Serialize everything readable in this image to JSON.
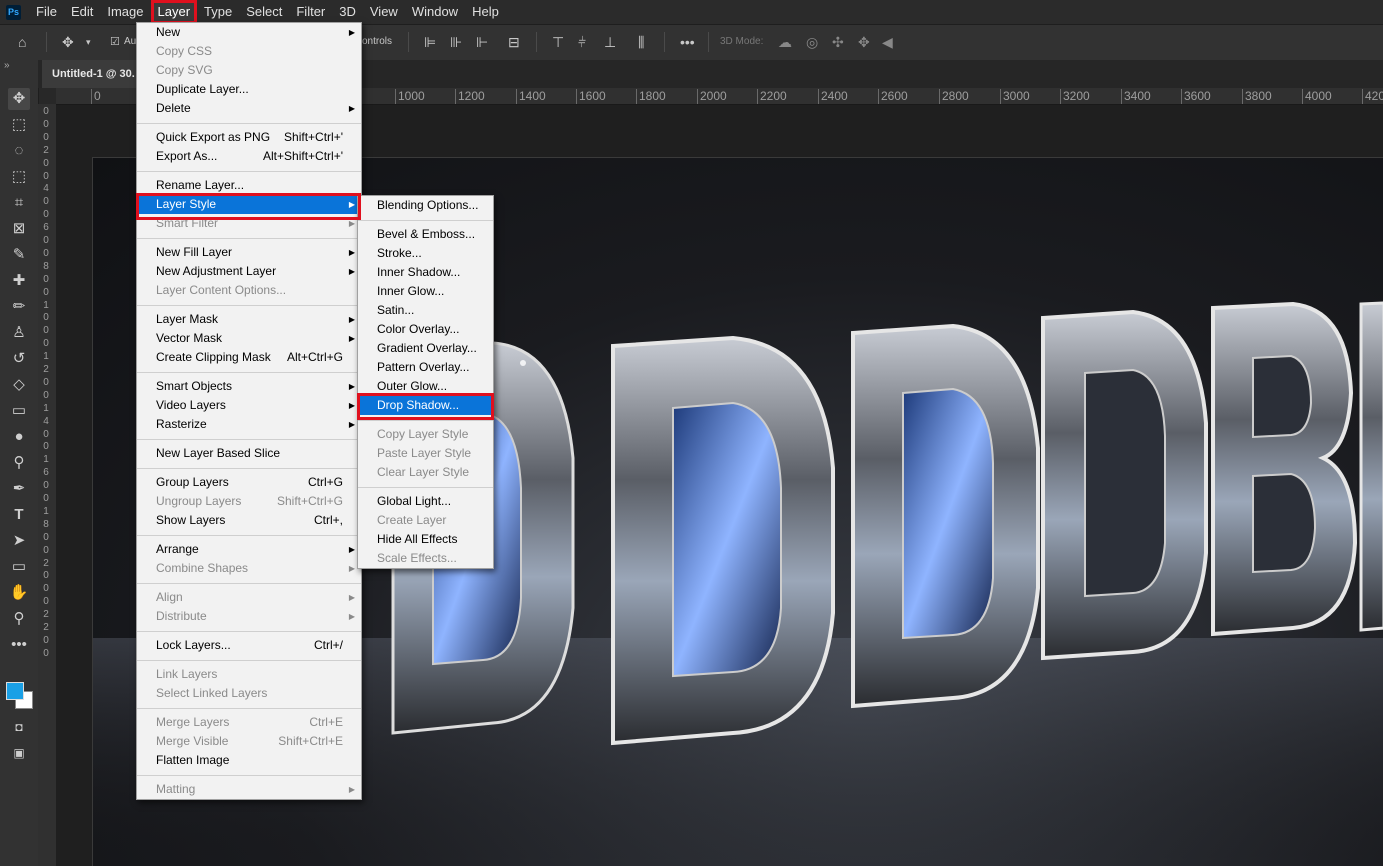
{
  "app": {
    "logo": "Ps"
  },
  "menubar": [
    "File",
    "Edit",
    "Image",
    "Layer",
    "Type",
    "Select",
    "Filter",
    "3D",
    "View",
    "Window",
    "Help"
  ],
  "optionsbar": {
    "auto_label": "Au",
    "controls_label": "ontrols",
    "mode_label": "3D Mode:"
  },
  "document": {
    "tab_label": "Untitled-1 @ 30."
  },
  "ruler": {
    "top": [
      "0",
      "1000",
      "1200",
      "1400",
      "1600",
      "1800",
      "2000",
      "2200",
      "2400",
      "2600",
      "2800",
      "3000",
      "3200",
      "3400",
      "3600",
      "3800",
      "4000",
      "420"
    ],
    "left": [
      "0",
      "0",
      "0",
      "2",
      "0",
      "0",
      "4",
      "0",
      "0",
      "6",
      "0",
      "0",
      "8",
      "0",
      "0",
      "1",
      "0",
      "0",
      "0",
      "1",
      "2",
      "0",
      "0",
      "1",
      "4",
      "0",
      "0",
      "1",
      "6",
      "0",
      "0",
      "1",
      "8",
      "0",
      "0",
      "2",
      "0",
      "0",
      "0",
      "2",
      "2",
      "0",
      "0"
    ]
  },
  "layer_menu": [
    {
      "label": "New",
      "arrow": true
    },
    {
      "label": "Copy CSS",
      "disabled": true
    },
    {
      "label": "Copy SVG",
      "disabled": true
    },
    {
      "label": "Duplicate Layer..."
    },
    {
      "label": "Delete",
      "arrow": true
    },
    {
      "sep": true
    },
    {
      "label": "Quick Export as PNG",
      "shortcut": "Shift+Ctrl+'"
    },
    {
      "label": "Export As...",
      "shortcut": "Alt+Shift+Ctrl+'"
    },
    {
      "sep": true
    },
    {
      "label": "Rename Layer..."
    },
    {
      "label": "Layer Style",
      "arrow": true,
      "highlight": true
    },
    {
      "label": "Smart Filter",
      "arrow": true,
      "disabled": true
    },
    {
      "sep": true
    },
    {
      "label": "New Fill Layer",
      "arrow": true
    },
    {
      "label": "New Adjustment Layer",
      "arrow": true
    },
    {
      "label": "Layer Content Options...",
      "disabled": true
    },
    {
      "sep": true
    },
    {
      "label": "Layer Mask",
      "arrow": true
    },
    {
      "label": "Vector Mask",
      "arrow": true
    },
    {
      "label": "Create Clipping Mask",
      "shortcut": "Alt+Ctrl+G"
    },
    {
      "sep": true
    },
    {
      "label": "Smart Objects",
      "arrow": true
    },
    {
      "label": "Video Layers",
      "arrow": true
    },
    {
      "label": "Rasterize",
      "arrow": true
    },
    {
      "sep": true
    },
    {
      "label": "New Layer Based Slice"
    },
    {
      "sep": true
    },
    {
      "label": "Group Layers",
      "shortcut": "Ctrl+G"
    },
    {
      "label": "Ungroup Layers",
      "shortcut": "Shift+Ctrl+G",
      "disabled": true
    },
    {
      "label": "Show Layers",
      "shortcut": "Ctrl+,"
    },
    {
      "sep": true
    },
    {
      "label": "Arrange",
      "arrow": true
    },
    {
      "label": "Combine Shapes",
      "arrow": true,
      "disabled": true
    },
    {
      "sep": true
    },
    {
      "label": "Align",
      "arrow": true,
      "disabled": true
    },
    {
      "label": "Distribute",
      "arrow": true,
      "disabled": true
    },
    {
      "sep": true
    },
    {
      "label": "Lock Layers...",
      "shortcut": "Ctrl+/"
    },
    {
      "sep": true
    },
    {
      "label": "Link Layers",
      "disabled": true
    },
    {
      "label": "Select Linked Layers",
      "disabled": true
    },
    {
      "sep": true
    },
    {
      "label": "Merge Layers",
      "shortcut": "Ctrl+E",
      "disabled": true
    },
    {
      "label": "Merge Visible",
      "shortcut": "Shift+Ctrl+E",
      "disabled": true
    },
    {
      "label": "Flatten Image"
    },
    {
      "sep": true
    },
    {
      "label": "Matting",
      "arrow": true,
      "disabled": true
    }
  ],
  "style_menu": [
    {
      "label": "Blending Options..."
    },
    {
      "sep": true
    },
    {
      "label": "Bevel & Emboss..."
    },
    {
      "label": "Stroke..."
    },
    {
      "label": "Inner Shadow..."
    },
    {
      "label": "Inner Glow..."
    },
    {
      "label": "Satin..."
    },
    {
      "label": "Color Overlay..."
    },
    {
      "label": "Gradient Overlay..."
    },
    {
      "label": "Pattern Overlay..."
    },
    {
      "label": "Outer Glow..."
    },
    {
      "label": "Drop Shadow...",
      "highlight": true
    },
    {
      "sep": true
    },
    {
      "label": "Copy Layer Style",
      "disabled": true
    },
    {
      "label": "Paste Layer Style",
      "disabled": true
    },
    {
      "label": "Clear Layer Style",
      "disabled": true
    },
    {
      "sep": true
    },
    {
      "label": "Global Light..."
    },
    {
      "label": "Create Layer",
      "disabled": true
    },
    {
      "label": "Hide All Effects"
    },
    {
      "label": "Scale Effects...",
      "disabled": true
    }
  ],
  "colors": {
    "highlight": "#0a74d9",
    "callout": "#e0101e",
    "foreground": "#1aa0e6",
    "background": "#ffffff"
  },
  "tools": [
    "move-icon",
    "marquee-icon",
    "lasso-icon",
    "object-select-icon",
    "crop-icon",
    "frame-icon",
    "eyedropper-icon",
    "healing-icon",
    "brush-icon",
    "stamp-icon",
    "history-brush-icon",
    "eraser-icon",
    "gradient-icon",
    "blur-icon",
    "dodge-icon",
    "pen-icon",
    "type-icon",
    "path-select-icon",
    "rectangle-icon",
    "hand-icon",
    "zoom-icon",
    "more-icon"
  ]
}
